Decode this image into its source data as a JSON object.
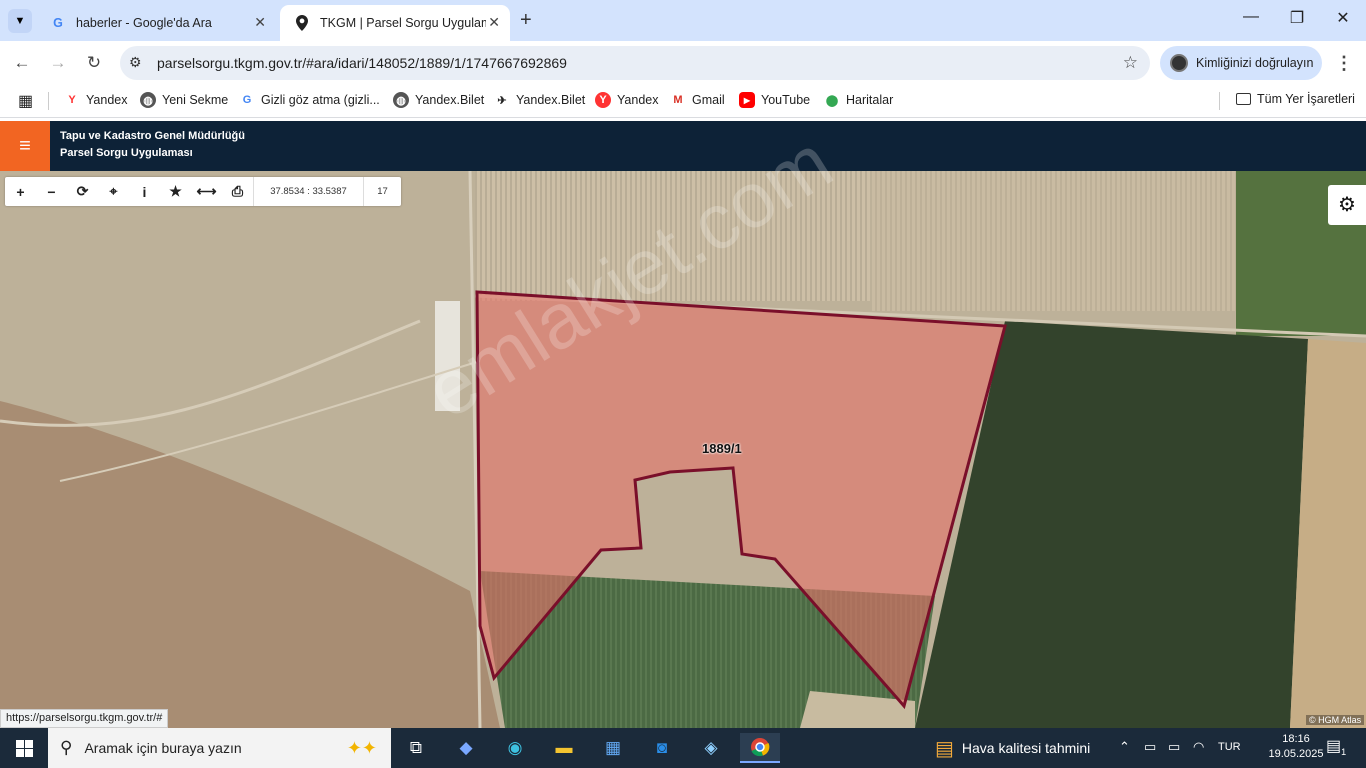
{
  "tabs": [
    {
      "title": "haberler - Google'da Ara",
      "favicon": "G"
    },
    {
      "title": "TKGM | Parsel Sorgu Uygulamas",
      "favicon": "map-pin-icon"
    }
  ],
  "toolbar": {
    "url": "parselsorgu.tkgm.gov.tr/#ara/idari/148052/1889/1/1747667692869",
    "identity_label": "Kimliğinizi doğrulayın"
  },
  "bookmarks": [
    {
      "label": "Yandex"
    },
    {
      "label": "Yeni Sekme"
    },
    {
      "label": "Gizli göz atma (gizli..."
    },
    {
      "label": "Yandex.Bilet"
    },
    {
      "label": "Yandex.Bilet"
    },
    {
      "label": "Yandex"
    },
    {
      "label": "Gmail"
    },
    {
      "label": "YouTube"
    },
    {
      "label": "Haritalar"
    },
    {
      "label": "Tüm Yer İşaretleri"
    }
  ],
  "app": {
    "title_line1": "Tapu ve Kadastro Genel Müdürlüğü",
    "title_line2": "Parsel Sorgu Uygulaması"
  },
  "map": {
    "coordinates": "37.8534 : 33.5387",
    "zoom": "17",
    "parcel_label": "1889/1",
    "watermark": "emlakjet.com",
    "attribution": "© HGM Atlas",
    "status_url": "https://parselsorgu.tkgm.gov.tr/#"
  },
  "taskbar": {
    "search_placeholder": "Aramak için buraya yazın",
    "weather": "Hava kalitesi tahmini",
    "language": "TUR",
    "time": "18:16",
    "date": "19.05.2025",
    "notifications": "1"
  },
  "colors": {
    "app_header": "#0d2237",
    "hamburger": "#f26522",
    "parcel_fill": "#e3756a",
    "parcel_stroke": "#7a0f2a"
  }
}
